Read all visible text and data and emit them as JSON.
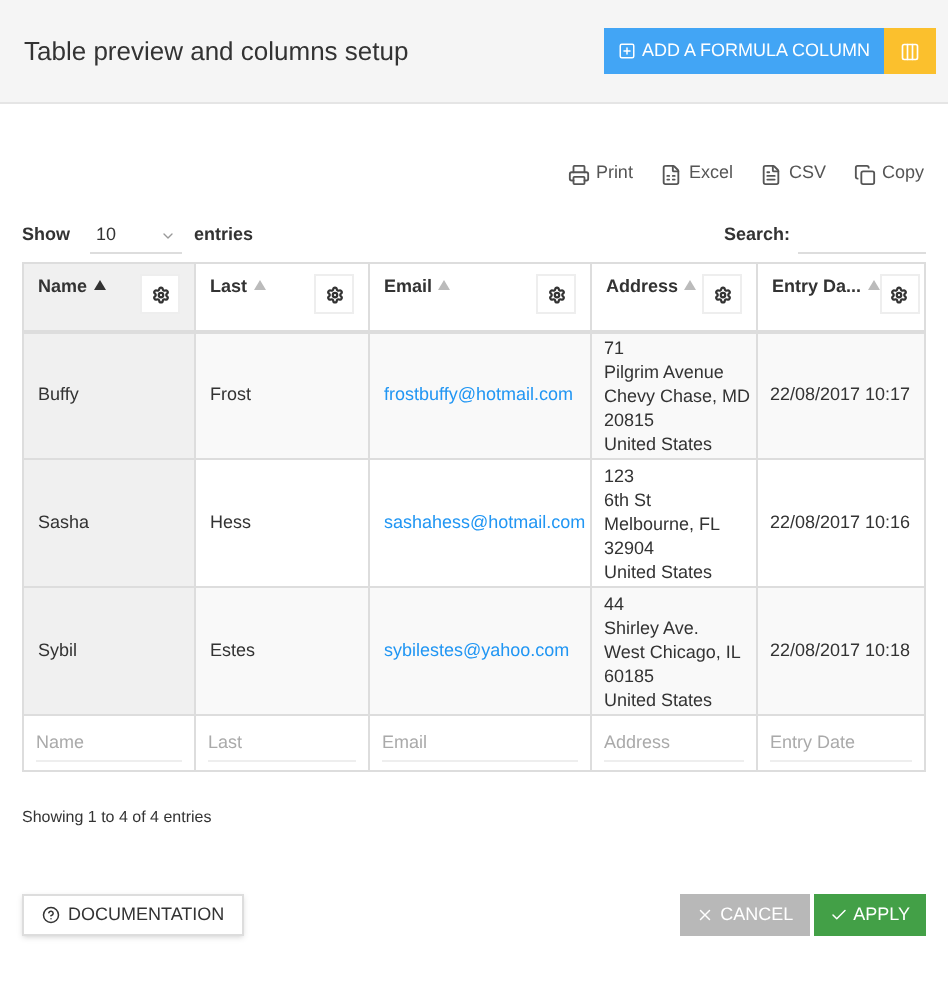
{
  "header": {
    "title": "Table preview and columns setup",
    "add_button": "ADD A FORMULA COLUMN"
  },
  "export_buttons": [
    {
      "kind": "print",
      "label": "Print"
    },
    {
      "kind": "excel",
      "label": "Excel"
    },
    {
      "kind": "csv",
      "label": "CSV"
    },
    {
      "kind": "copy",
      "label": "Copy"
    }
  ],
  "length_menu": {
    "before": "Show",
    "value": "10",
    "after": "entries"
  },
  "search": {
    "label": "Search:"
  },
  "table": {
    "columns": [
      {
        "label": "Name",
        "sorted": true
      },
      {
        "label": "Last",
        "sorted": false
      },
      {
        "label": "Email",
        "sorted": false
      },
      {
        "label": "Address",
        "sorted": false
      },
      {
        "label": "Entry Da...",
        "sorted": false
      }
    ],
    "rows": [
      {
        "name": "Buffy",
        "last": "Frost",
        "email": "frostbuffy@hotmail.com",
        "address": [
          "71",
          "Pilgrim Avenue",
          "Chevy Chase, MD",
          "20815",
          "United States"
        ],
        "entry_date": "22/08/2017 10:17"
      },
      {
        "name": "Sasha",
        "last": "Hess",
        "email": "sashahess@hotmail.com",
        "address": [
          "123",
          "6th St",
          "Melbourne, FL",
          "32904",
          "United States"
        ],
        "entry_date": "22/08/2017 10:16"
      },
      {
        "name": "Sybil",
        "last": "Estes",
        "email": "sybilestes@yahoo.com",
        "address": [
          "44",
          "Shirley Ave.",
          "West Chicago, IL",
          "60185",
          "United States"
        ],
        "entry_date": "22/08/2017 10:18"
      }
    ],
    "filters": [
      {
        "placeholder": "Name"
      },
      {
        "placeholder": "Last"
      },
      {
        "placeholder": "Email"
      },
      {
        "placeholder": "Address"
      },
      {
        "placeholder": "Entry Date"
      }
    ]
  },
  "info": "Showing 1 to 4 of 4 entries",
  "footer": {
    "documentation": "DOCUMENTATION",
    "cancel": {
      "label": "CANCEL",
      "disabled": true
    },
    "apply": "APPLY"
  }
}
